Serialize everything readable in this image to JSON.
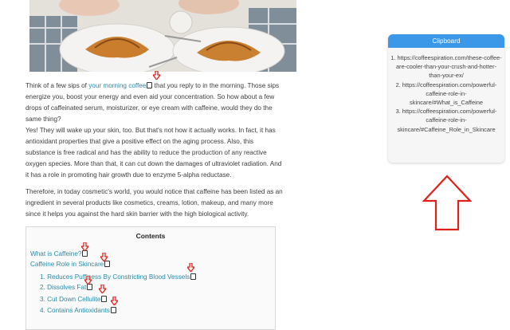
{
  "paragraphs": {
    "p1_before": "Think of a few sips of ",
    "p1_link": "your morning coffee",
    "p1_after": " that you reply to in the morning. Those sips energize you, boost your energy and even aid your concentration. So how about a few drops of caffeinated serum, moisturizer, or eye cream with caffeine, would they do the same thing?",
    "p2": "Yes! They will wake up your skin, too. But that's not how it actually works. In fact, it has antioxidant properties that give a positive effect on the aging process. Also, this substance is free radical and has the ability to reduce the production of any reactive oxygen species. More than that, it can cut down the damages of ultraviolet radiation. And it has a role in promoting hair growth due to enzyme 5-alpha reductase.",
    "p3": "Therefore, in today cosmetic's world, you would notice that caffeine has been listed as an ingredient in several products like cosmetics, creams, lotion, makeup, and many more since it helps you against the hard skin barrier with the high biological activity."
  },
  "toc": {
    "title": "Contents",
    "items": [
      "What is Caffeine?",
      "Caffeine Role in Skincare",
      "1. Reduces Puffiness By Constricting Blood Vessels",
      "2. Dissolves Fat",
      "3. Cut Down Cellulite",
      "4. Contains Antioxidants"
    ]
  },
  "clipboard": {
    "title": "Clipboard",
    "entries": [
      "1. https://coffeespiration.com/these-coffee-are-cooler-than-your-crush-and-hotter-than-your-ex/",
      "2. https://coffeespiration.com/powerful-caffeine-role-in-skincare/#What_is_Caffeine",
      "3. https://coffeespiration.com/powerful-caffeine-role-in-skincare/#Caffeine_Role_in_Skincare"
    ]
  },
  "colors": {
    "link": "#2a8aa6",
    "clipboard_header": "#3b98e8",
    "arrow": "#e0201a"
  },
  "icons": {
    "copy": "copy-icon",
    "pointer_arrow": "arrow-down-icon",
    "big_arrow": "arrow-up-icon"
  }
}
